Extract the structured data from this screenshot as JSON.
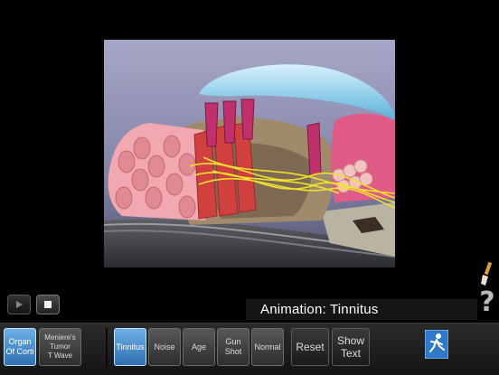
{
  "caption": "Animation: Tinnitus",
  "help_glyph": "?",
  "left_group": [
    {
      "label": "Organ\nOf Corti",
      "active": true
    },
    {
      "label": "Meniere's\nTumor\nT Wave",
      "active": false
    }
  ],
  "mid_group": [
    {
      "label": "Tinnitus",
      "active": true
    },
    {
      "label": "Noise",
      "active": false
    },
    {
      "label": "Age",
      "active": false
    },
    {
      "label": "Gun\nShot",
      "active": false
    },
    {
      "label": "Normal",
      "active": false
    }
  ],
  "reset_label": "Reset",
  "show_text_label": "Show\nText",
  "icons": {
    "play": "play-icon",
    "stop": "stop-icon",
    "brush": "paintbrush-icon",
    "help": "help-icon",
    "app": "running-figure-icon"
  }
}
